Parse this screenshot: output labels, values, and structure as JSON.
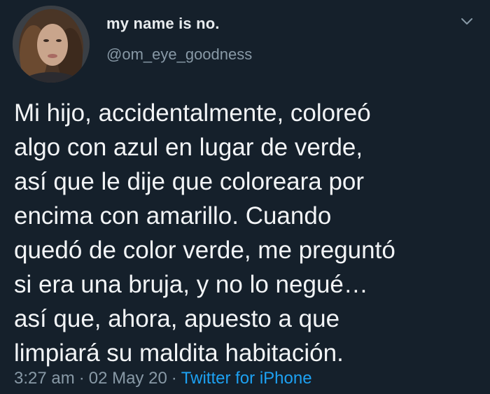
{
  "user": {
    "display_name": "my name is no.",
    "handle": "@om_eye_goodness"
  },
  "tweet": {
    "lines": [
      "Mi hijo, accidentalmente, coloreó",
      "algo con azul en lugar de verde,",
      "así que le dije que coloreara por",
      "encima con amarillo. Cuando",
      "quedó de color verde, me preguntó",
      "si era una bruja, y no lo negué…",
      "así que, ahora, apuesto a que",
      "limpiará su maldita habitación."
    ]
  },
  "meta": {
    "time": "3:27 am",
    "date": "02 May 20",
    "separator": "·",
    "source": "Twitter for iPhone"
  },
  "icons": {
    "menu": "chevron-down-icon",
    "avatar": "avatar"
  },
  "colors": {
    "background": "#15202b",
    "text": "#f2f4f6",
    "secondary": "#8899a6",
    "link": "#1da1f2"
  }
}
